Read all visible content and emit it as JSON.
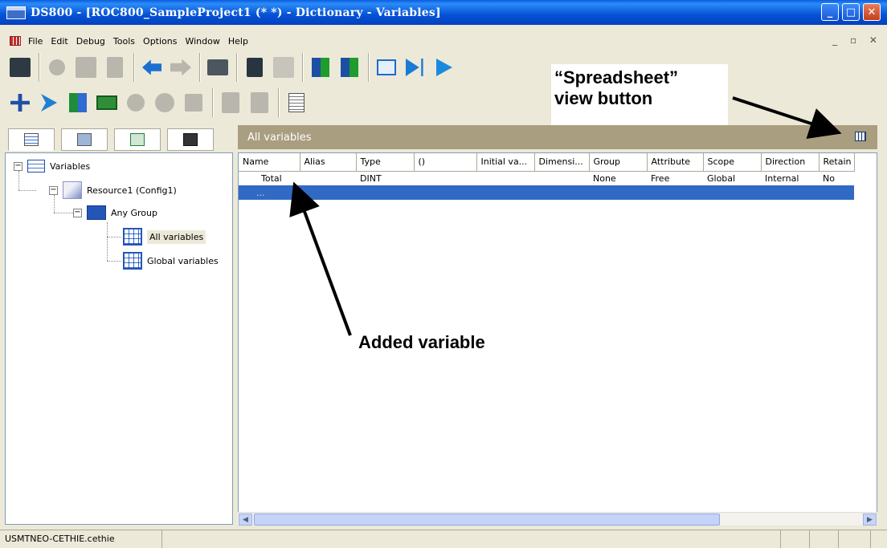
{
  "window": {
    "title": "DS800 - [ROC800_SampleProject1 (*  *) - Dictionary - Variables]"
  },
  "window_controls": {
    "minimize": "_",
    "maximize": "□",
    "close": "✕"
  },
  "menu": {
    "items": [
      "File",
      "Edit",
      "Debug",
      "Tools",
      "Options",
      "Window",
      "Help"
    ],
    "mdi_controls": "_ ▫ ✕"
  },
  "toolbar1": {
    "icons": [
      "save-icon",
      "cut-icon",
      "copy-icon",
      "paste-icon",
      "undo-icon",
      "redo-icon",
      "print-icon",
      "find-icon",
      "grid-icon",
      "sort-ascending-icon",
      "sort-descending-icon",
      "view-icon",
      "step-icon",
      "run-icon"
    ]
  },
  "toolbar2": {
    "icons": [
      "connect-icon",
      "arrow-icon",
      "cube-icon",
      "card-icon",
      "circle-icon",
      "gear-icon",
      "puzzle-icon",
      "doc-in-icon",
      "doc-out-icon",
      "calculator-icon"
    ]
  },
  "left_tabs": [
    "variables-tab",
    "network-tab",
    "tree-tab",
    "window-tab"
  ],
  "tree": {
    "root": "Variables",
    "resource": "Resource1 (Config1)",
    "group": "Any Group",
    "all": "All variables",
    "global": "Global variables"
  },
  "panel": {
    "title": "All variables"
  },
  "grid": {
    "columns": [
      "Name",
      "Alias",
      "Type",
      "()",
      "Initial va...",
      "Dimensi...",
      "Group",
      "Attribute",
      "Scope",
      "Direction",
      "Retain"
    ],
    "rows": [
      [
        "Total",
        "",
        "DINT",
        "",
        "",
        "",
        "None",
        "Free",
        "Global",
        "Internal",
        "No"
      ],
      [
        "...",
        "",
        "",
        "",
        "",
        "",
        "",
        "",
        "",
        "",
        ""
      ]
    ],
    "selected_row": 1
  },
  "status": {
    "user": "USMTNEO-CETHIE.cethie"
  },
  "annotations": {
    "spreadsheet_line1": "“Spreadsheet”",
    "spreadsheet_line2": "view button",
    "added": "Added variable"
  },
  "colors": {
    "titlebar": "#0552d6",
    "panel_header": "#aa9e80",
    "selection": "#316ac5"
  }
}
